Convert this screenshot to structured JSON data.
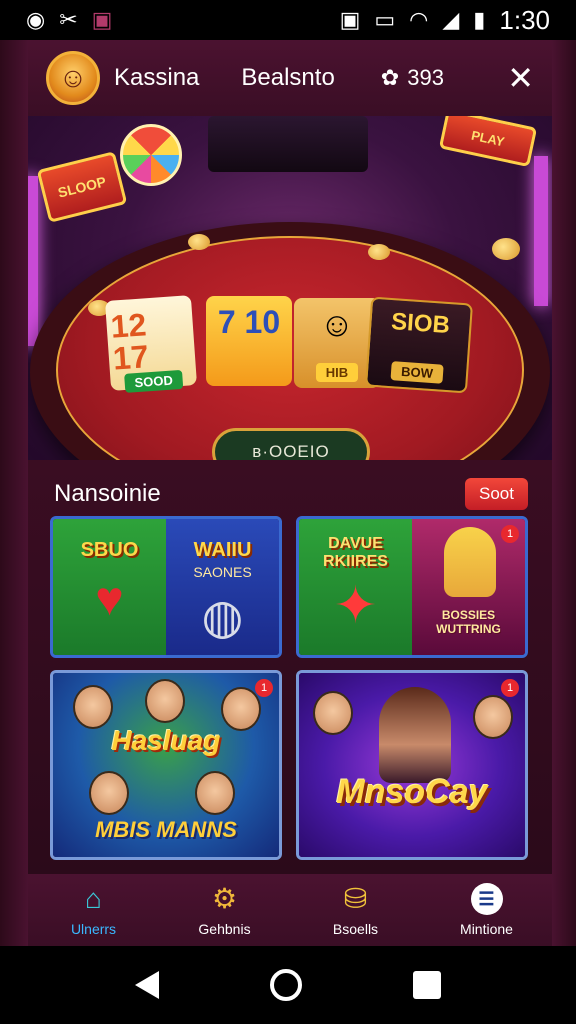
{
  "status_bar": {
    "time": "1:30",
    "left_icons": [
      "circle-icon",
      "tools-icon",
      "bag-icon"
    ],
    "right_icons": [
      "nfc-icon",
      "battery-saver-icon",
      "wifi-icon",
      "signal-icon",
      "battery-icon"
    ]
  },
  "header": {
    "brand": "Kassina",
    "title": "Bealsnto",
    "coins": "393",
    "coin_icon": "gear-coin-icon",
    "close_icon": "close-icon"
  },
  "hero": {
    "sign_left": "SLOOP",
    "sign_right": "PLAY",
    "cards": [
      {
        "face": "12 17",
        "plate": "SOOD"
      },
      {
        "face": "7 10",
        "plate": ""
      },
      {
        "face": "☺",
        "plate": "HIB"
      },
      {
        "face": "SIOB",
        "plate": "BOW"
      }
    ],
    "pot_label": "ʙ·OOEIO"
  },
  "section": {
    "title": "Nansoinie",
    "sort_label": "Soot"
  },
  "tiles": [
    {
      "left_label": "SBUO",
      "right_label": "WAIIU",
      "right_sub": "SAONES"
    },
    {
      "left_label": "DAVUE RKIIRES",
      "right_text": "BOSSIES WUTTRING",
      "badge": "1"
    },
    {
      "title": "Hasluag",
      "footer": "MBIS MANNS",
      "badge": "1"
    },
    {
      "title": "MnsoCay",
      "badge": "1"
    }
  ],
  "bottom_nav": [
    {
      "label": "Ulnerrs",
      "icon": "home-icon",
      "active": true
    },
    {
      "label": "Gehbnis",
      "icon": "gear-icon",
      "active": false
    },
    {
      "label": "Bsoells",
      "icon": "chest-icon",
      "active": false
    },
    {
      "label": "Mintione",
      "icon": "menu-icon",
      "active": false
    }
  ]
}
